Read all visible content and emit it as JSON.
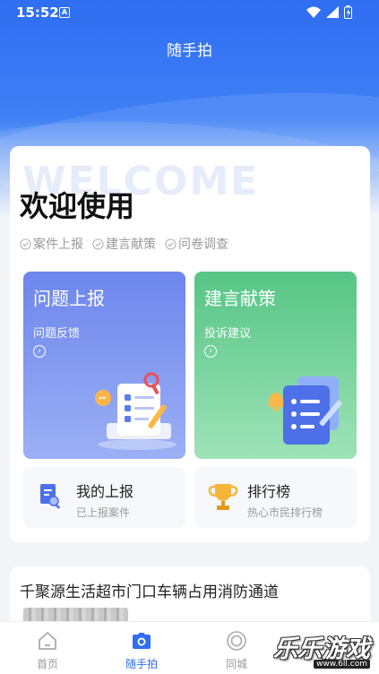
{
  "status_bar": {
    "time": "15:52",
    "notification_badge": "A"
  },
  "header": {
    "title": "随手拍"
  },
  "welcome": {
    "bg_text": "WELCOME",
    "title": "欢迎使用",
    "tags": [
      "案件上报",
      "建言献策",
      "问卷调查"
    ]
  },
  "cards": {
    "report": {
      "title": "问题上报",
      "subtitle": "问题反馈",
      "arrow": "›",
      "color": "#6d86ec"
    },
    "suggest": {
      "title": "建言献策",
      "subtitle": "投诉建议",
      "arrow": "›",
      "color": "#56c585"
    }
  },
  "small_cards": {
    "my_reports": {
      "title": "我的上报",
      "subtitle": "已上报案件"
    },
    "ranking": {
      "title": "排行榜",
      "subtitle": "热心市民排行榜"
    }
  },
  "news": {
    "title": "千聚源生活超市门口车辆占用消防通道"
  },
  "tabbar": {
    "items": [
      {
        "label": "首页",
        "icon": "home-icon",
        "active": false
      },
      {
        "label": "随手拍",
        "icon": "camera-icon",
        "active": true
      },
      {
        "label": "同城",
        "icon": "city-ring-icon",
        "active": false
      }
    ],
    "active_color": "#2f6df2"
  },
  "watermark": {
    "text": "乐乐游戏",
    "url": "www.6ll.com"
  }
}
